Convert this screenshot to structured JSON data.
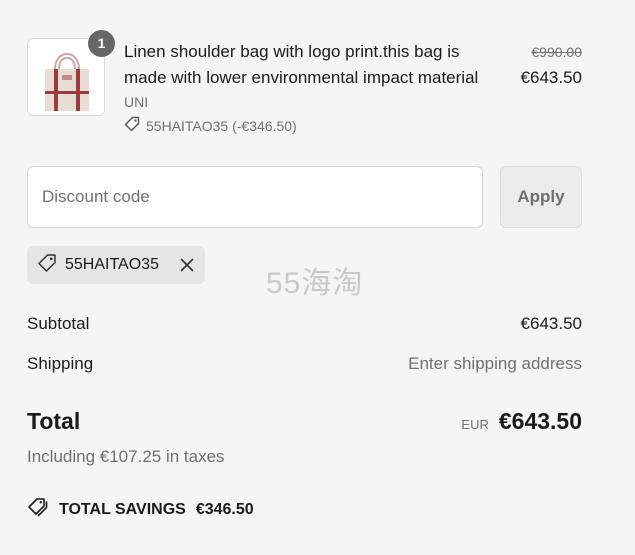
{
  "line_item": {
    "quantity": "1",
    "title": "Linen shoulder bag with logo print.this bag is made with lower environmental impact material",
    "variant": "UNI",
    "discount_text": "55HAITAO35 (-€346.50)",
    "price_original": "€990.00",
    "price_final": "€643.50",
    "thumbnail_icon": "tote-bag-image"
  },
  "discount": {
    "placeholder": "Discount code",
    "apply_label": "Apply",
    "applied_code": "55HAITAO35"
  },
  "watermark": "55海淘",
  "summary": {
    "subtotal_label": "Subtotal",
    "subtotal_value": "€643.50",
    "shipping_label": "Shipping",
    "shipping_value": "Enter shipping address",
    "total_label": "Total",
    "currency": "EUR",
    "total_value": "€643.50",
    "taxes_text": "Including €107.25 in taxes",
    "savings_label": "TOTAL SAVINGS",
    "savings_value": "€346.50"
  },
  "colors": {
    "background": "#f5f5f5",
    "text": "#1a1a1a",
    "muted": "#707070",
    "badge": "#666666"
  }
}
